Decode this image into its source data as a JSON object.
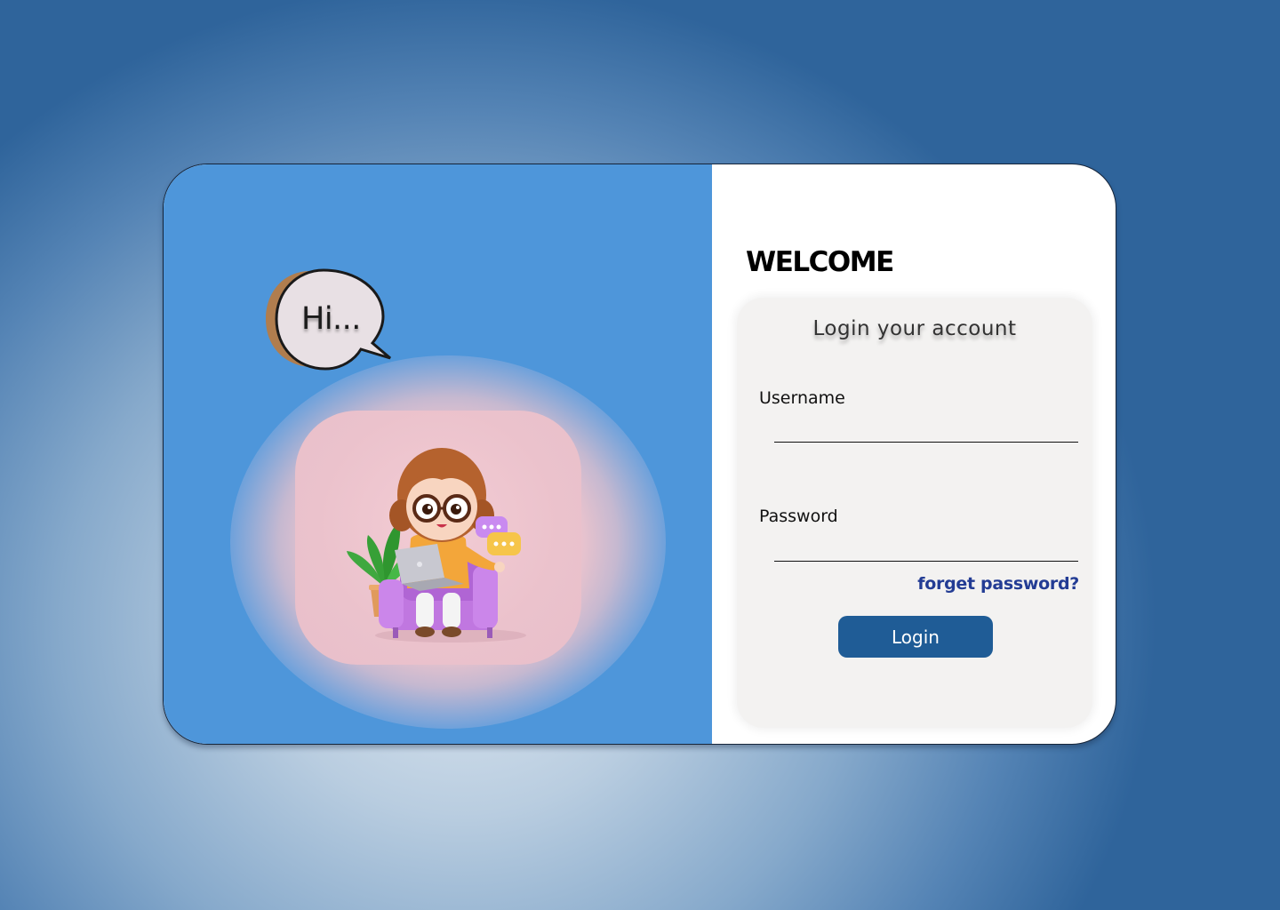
{
  "hero": {
    "greeting": "Hi..."
  },
  "login": {
    "welcome_title": "WELCOME",
    "form_heading": "Login your account",
    "username_label": "Username",
    "username_value": "",
    "password_label": "Password",
    "password_value": "",
    "forgot_password_label": "forget password?",
    "login_button_label": "Login"
  },
  "colors": {
    "left_panel": "#4e96da",
    "button": "#1f5c96",
    "link": "#233c94",
    "form_box": "#f3f2f1"
  }
}
